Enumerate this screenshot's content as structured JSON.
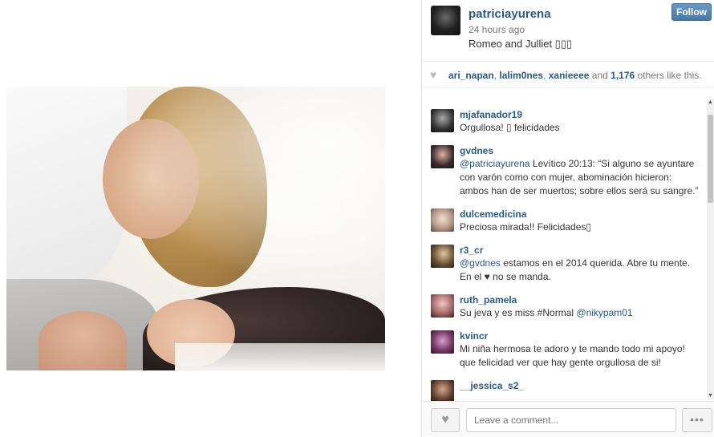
{
  "post": {
    "username": "patriciayurena",
    "timestamp": "24 hours ago",
    "caption": "Romeo and Julliet ▯▯▯",
    "follow_label": "Follow"
  },
  "likes": {
    "users": [
      "ari_napan",
      "lalim0nes",
      "xanieeee"
    ],
    "sep1": ", ",
    "sep2": ", ",
    "and": " and ",
    "count": "1,176",
    "suffix": " others like this."
  },
  "comments": [
    {
      "user": "mjafanador19",
      "text": "Orgullosa! ▯ felicidades"
    },
    {
      "user": "gvdnes",
      "mention": "@patriciayurena",
      "text": " Levítico 20:13: “Si alguno se ayuntare con varón como con mujer, abominación hicieron: ambos han de ser muertos; sobre ellos será su sangre.”"
    },
    {
      "user": "dulcemedicina",
      "text": "Preciosa mirada!! Felicidades▯"
    },
    {
      "user": "r3_cr",
      "mention": "@gvdnes",
      "text": " estamos en el 2014 querida. Abre tu mente. En el ♥ no se manda."
    },
    {
      "user": "ruth_pamela",
      "text": "Su jeva y es miss #Normal ",
      "mention_after": "@nikypam01"
    },
    {
      "user": "kvincr",
      "text": "Mi niña hermosa te adoro y te mando todo mi apoyo! que felicidad ver que hay gente orgullosa de si!"
    },
    {
      "user": "__jessica_s2_",
      "text": ""
    }
  ],
  "footer": {
    "comment_placeholder": "Leave a comment...",
    "more_label": "•••"
  },
  "icons": {
    "heart": "heart-icon",
    "like_button": "heart-icon",
    "more": "ellipsis-icon"
  },
  "colors": {
    "link": "#2b5a83",
    "follow_button": "#4a78a4"
  }
}
